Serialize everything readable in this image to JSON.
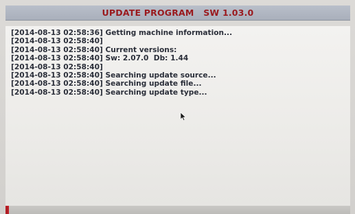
{
  "window": {
    "title": "UPDATE PROGRAM   SW 1.03.0"
  },
  "log": {
    "lines": [
      "[2014-08-13 02:58:36] Getting machine information...",
      "[2014-08-13 02:58:40]",
      "[2014-08-13 02:58:40] Current versions:",
      "[2014-08-13 02:58:40] Sw: 2.07.0  Db: 1.44",
      "[2014-08-13 02:58:40]",
      "[2014-08-13 02:58:40] Searching update source...",
      "[2014-08-13 02:58:40] Searching update file...",
      "[2014-08-13 02:58:40] Searching update type..."
    ]
  },
  "progress": {
    "fraction": 0.01
  },
  "colors": {
    "title_text": "#9a1a1e",
    "title_bar": "#b4bac5",
    "log_text": "#2b2f3a",
    "progress_fill": "#c8222a"
  },
  "icons": {
    "cursor": "mouse-pointer-icon"
  }
}
